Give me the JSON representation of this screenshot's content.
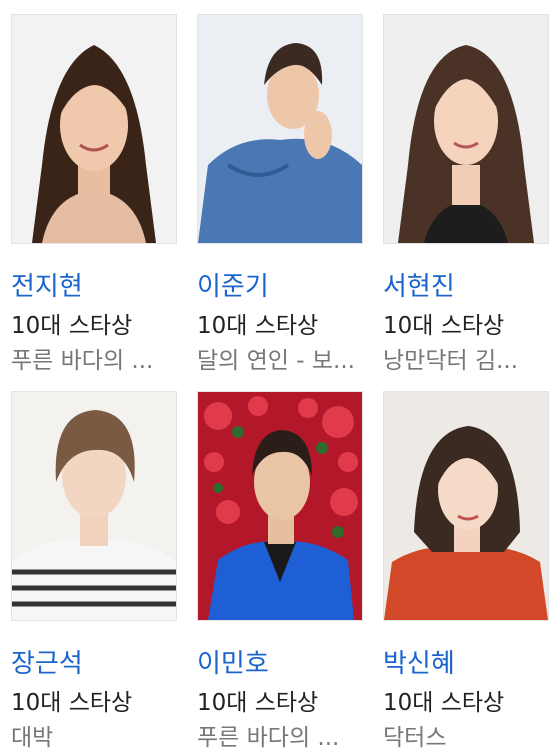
{
  "cards": [
    {
      "name": "전지현",
      "award": "10대 스타상",
      "work": "푸른 바다의 ..."
    },
    {
      "name": "이준기",
      "award": "10대 스타상",
      "work": "달의 연인 - 보..."
    },
    {
      "name": "서현진",
      "award": "10대 스타상",
      "work": "낭만닥터 김..."
    },
    {
      "name": "장근석",
      "award": "10대 스타상",
      "work": "대박"
    },
    {
      "name": "이민호",
      "award": "10대 스타상",
      "work": "푸른 바다의 ..."
    },
    {
      "name": "박신혜",
      "award": "10대 스타상",
      "work": "닥터스"
    }
  ],
  "colors": {
    "name_link": "#1a64cc",
    "award_text": "#222222",
    "work_text": "#777777"
  }
}
